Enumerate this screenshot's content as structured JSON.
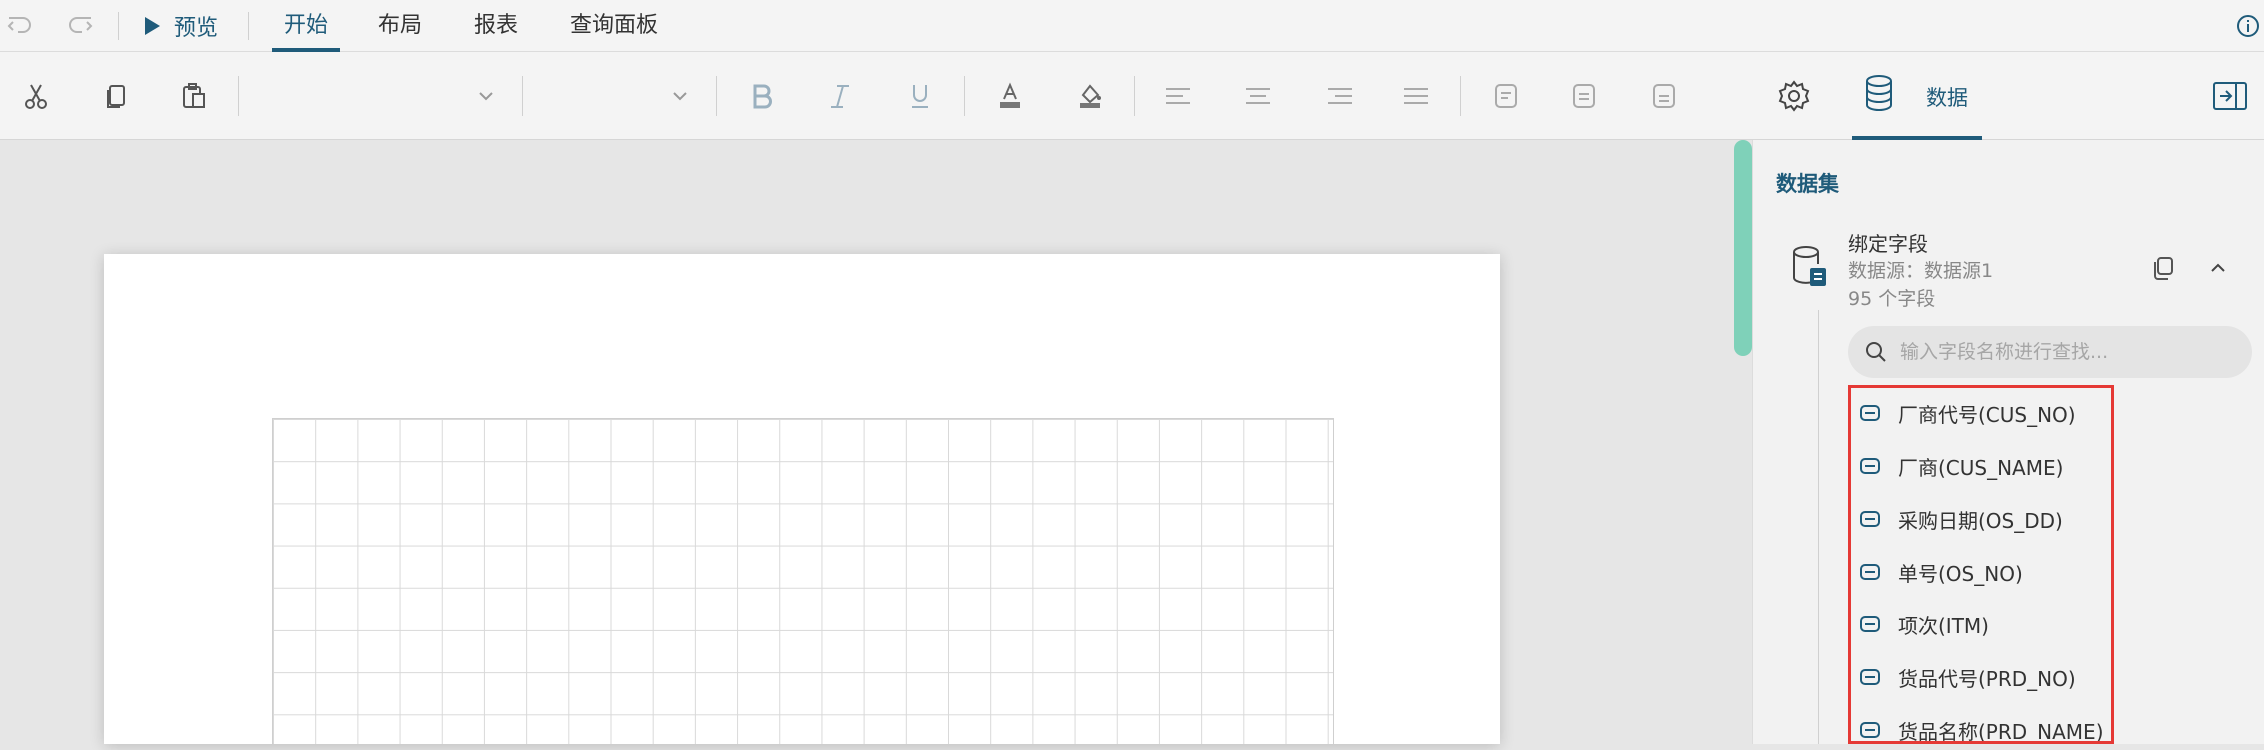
{
  "menubar": {
    "preview_label": "预览",
    "tabs": [
      {
        "label": "开始",
        "active": true
      },
      {
        "label": "布局",
        "active": false
      },
      {
        "label": "报表",
        "active": false
      },
      {
        "label": "查询面板",
        "active": false
      }
    ],
    "icons": [
      "undo-icon",
      "redo-icon",
      "play-icon",
      "info-icon"
    ]
  },
  "ribbon": {
    "icons": [
      "cut-icon",
      "copy-icon",
      "paste-icon",
      "bold-icon",
      "italic-icon",
      "underline-icon",
      "font-color-icon",
      "fill-color-icon",
      "align-left-icon",
      "align-center-icon",
      "align-right-icon",
      "align-justify-icon",
      "field-box-icon",
      "settings-icon",
      "database-icon",
      "collapse-panel-icon"
    ],
    "data_tab_label": "数据"
  },
  "panel": {
    "section_title": "数据集",
    "dataset": {
      "name": "绑定字段",
      "source": "数据源：数据源1",
      "count": "95 个字段"
    },
    "search": {
      "placeholder": "输入字段名称进行查找..."
    },
    "fields": [
      {
        "label": "厂商代号(CUS_NO)"
      },
      {
        "label": "厂商(CUS_NAME)"
      },
      {
        "label": "采购日期(OS_DD)"
      },
      {
        "label": "单号(OS_NO)"
      },
      {
        "label": "项次(ITM)"
      },
      {
        "label": "货品代号(PRD_NO)"
      },
      {
        "label": "货品名称(PRD_NAME)"
      }
    ]
  },
  "colors": {
    "accent": "#1f5b7a",
    "scrollbar": "#7fd1b9",
    "highlight": "#e53935"
  }
}
